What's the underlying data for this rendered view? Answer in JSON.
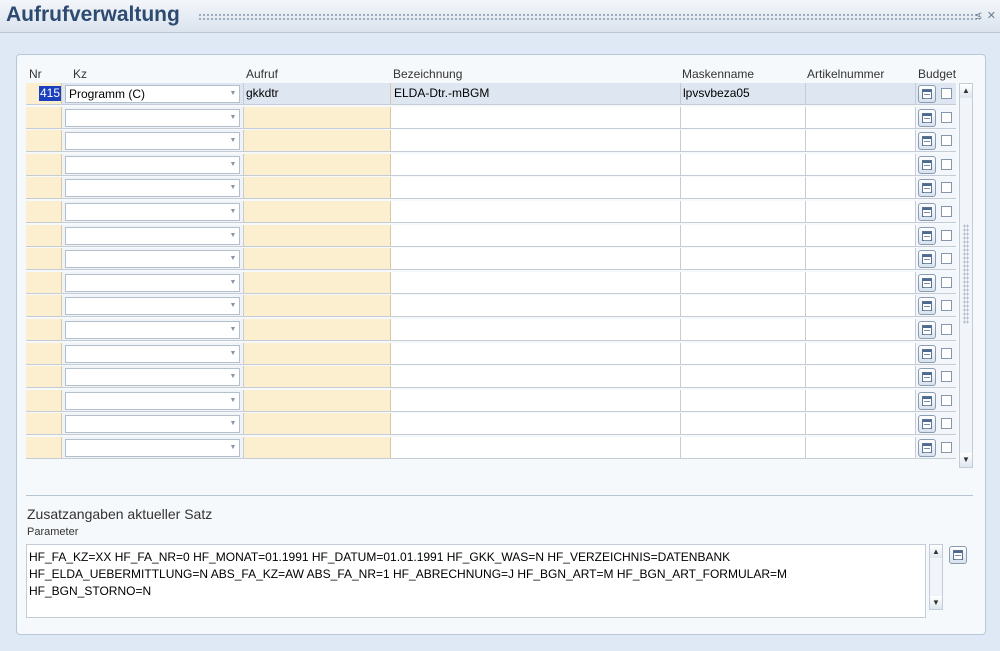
{
  "window": {
    "title": "Aufrufverwaltung",
    "minimize_glyph": "≤",
    "close_glyph": "✕"
  },
  "table": {
    "columns": {
      "nr": "Nr",
      "kz": "Kz",
      "aufruf": "Aufruf",
      "bezeichnung": "Bezeichnung",
      "maskenname": "Maskenname",
      "artikelnummer": "Artikelnummer",
      "budget": "Budget"
    },
    "rows": [
      {
        "nr": "415",
        "kz": "Programm (C)",
        "aufruf": "gkkdtr",
        "bezeichnung": "ELDA-Dtr.-mBGM",
        "maskenname": "lpvsvbeza05",
        "artikelnummer": ""
      }
    ],
    "empty_row_count": 16,
    "icons": {
      "edit": "notepad-icon",
      "combo_arrow": "chevron-down-icon",
      "scroll_up": "arrow-up-icon",
      "scroll_down": "arrow-down-icon"
    }
  },
  "details": {
    "title": "Zusatzangaben aktueller Satz",
    "parameter_label": "Parameter",
    "parameter_value": "HF_FA_KZ=XX HF_FA_NR=0 HF_MONAT=01.1991 HF_DATUM=01.01.1991 HF_GKK_WAS=N HF_VERZEICHNIS=DATENBANK\nHF_ELDA_UEBERMITTLUNG=N ABS_FA_KZ=AW ABS_FA_NR=1 HF_ABRECHNUNG=J HF_BGN_ART=M HF_BGN_ART_FORMULAR=M\nHF_BGN_STORNO=N"
  },
  "colors": {
    "required_field": "#fbefcf",
    "selection": "#1a3fbf",
    "title": "#2d4a70"
  }
}
